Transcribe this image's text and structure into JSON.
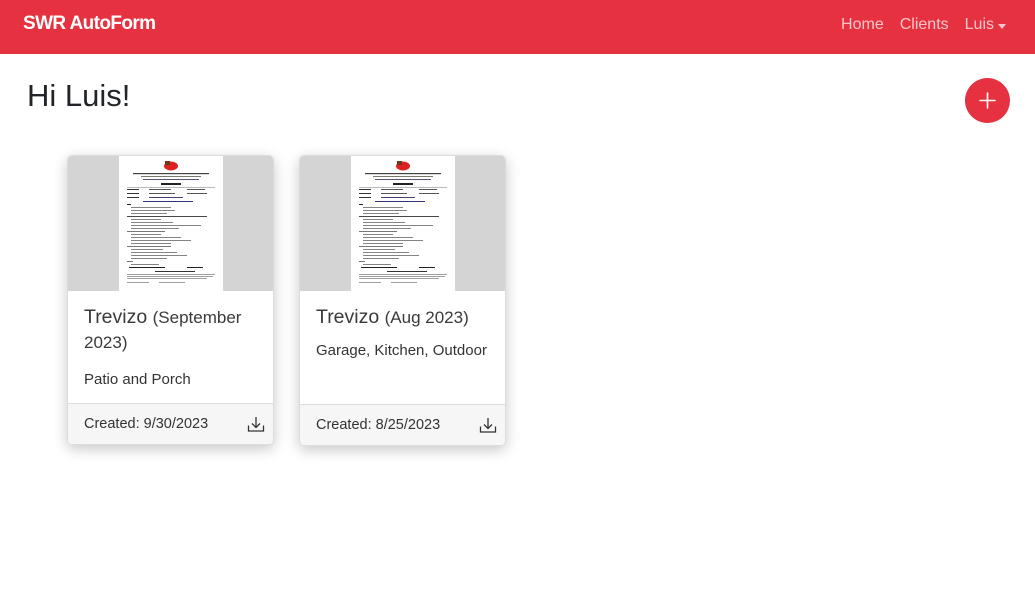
{
  "navbar": {
    "brand": "SWR AutoForm",
    "links": [
      {
        "label": "Home"
      },
      {
        "label": "Clients"
      },
      {
        "label": "Luis"
      }
    ],
    "background": "#e63240"
  },
  "page": {
    "greeting": "Hi Luis!",
    "add_icon": "plus-icon"
  },
  "cards": [
    {
      "client": "Trevizo",
      "period": "(September 2023)",
      "areas": "Patio and Porch",
      "created": "Created: 9/30/2023",
      "download_icon": "download-icon"
    },
    {
      "client": "Trevizo",
      "period": "(Aug 2023)",
      "areas": "Garage, Kitchen, Outdoor",
      "created": "Created: 8/25/2023",
      "download_icon": "download-icon"
    }
  ]
}
